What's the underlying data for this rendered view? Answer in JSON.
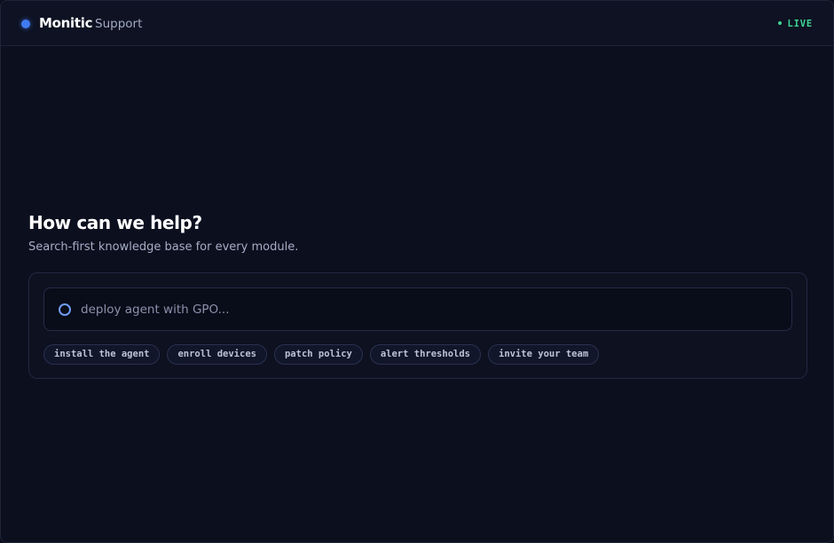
{
  "header": {
    "brand_name": "Monitic",
    "section": "Support",
    "status": "LIVE"
  },
  "hero": {
    "title": "How can we help?",
    "subtitle": "Search-first knowledge base for every module."
  },
  "search": {
    "placeholder": "deploy agent with GPO...",
    "value": ""
  },
  "suggestions": [
    "install the agent",
    "enroll devices",
    "patch policy",
    "alert thresholds",
    "invite your team"
  ],
  "colors": {
    "accent": "#3f7af0",
    "status": "#3fd394",
    "background": "#0c0f1e"
  }
}
